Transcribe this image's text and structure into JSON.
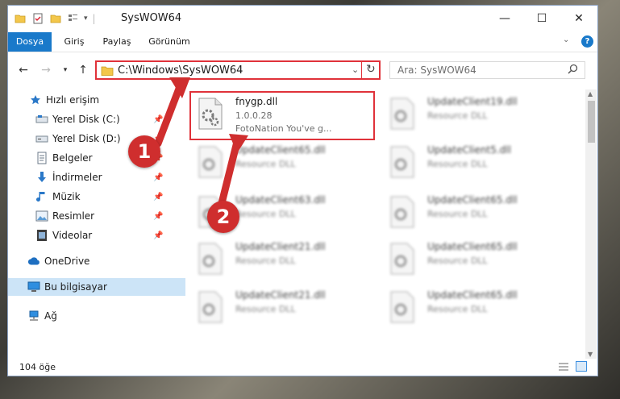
{
  "window": {
    "title": "SysWOW64"
  },
  "ribbon": {
    "tabs": [
      "Dosya",
      "Giriş",
      "Paylaş",
      "Görünüm"
    ]
  },
  "address": {
    "path": "C:\\Windows\\SysWOW64"
  },
  "search": {
    "placeholder": "Ara: SysWOW64"
  },
  "sidebar": {
    "items": [
      {
        "label": "Hızlı erişim",
        "icon": "star-icon"
      },
      {
        "label": "Yerel Disk (C:)",
        "icon": "drive-icon"
      },
      {
        "label": "Yerel Disk (D:)",
        "icon": "drive-icon"
      },
      {
        "label": "Belgeler",
        "icon": "documents-icon"
      },
      {
        "label": "İndirmeler",
        "icon": "download-icon"
      },
      {
        "label": "Müzik",
        "icon": "music-icon"
      },
      {
        "label": "Resimler",
        "icon": "pictures-icon"
      },
      {
        "label": "Videolar",
        "icon": "videos-icon"
      },
      {
        "label": "OneDrive",
        "icon": "cloud-icon"
      },
      {
        "label": "Bu bilgisayar",
        "icon": "computer-icon"
      },
      {
        "label": "Ağ",
        "icon": "network-icon"
      }
    ]
  },
  "files": [
    {
      "name": "fnygp.dll",
      "version": "1.0.0.28",
      "company": "FotoNation You've g..."
    },
    {
      "name": "UpdateClient19.dll",
      "desc": "Resource DLL"
    },
    {
      "name": "UpdateClient65.dll",
      "desc": "Resource DLL"
    },
    {
      "name": "UpdateClient5.dll",
      "desc": "Resource DLL"
    },
    {
      "name": "UpdateClient63.dll",
      "desc": "Resource DLL"
    },
    {
      "name": "UpdateClient65.dll",
      "desc": "Resource DLL"
    },
    {
      "name": "UpdateClient21.dll",
      "desc": "Resource DLL"
    },
    {
      "name": "UpdateClient65.dll",
      "desc": "Resource DLL"
    },
    {
      "name": "UpdateClient21.dll",
      "desc": "Resource DLL"
    },
    {
      "name": "UpdateClient65.dll",
      "desc": "Resource DLL"
    }
  ],
  "status": {
    "count": "104 öğe"
  },
  "annotations": {
    "step1": "1",
    "step2": "2"
  },
  "colors": {
    "accent": "#1979ca",
    "highlight": "#e0323a",
    "selected": "#cce4f7"
  }
}
